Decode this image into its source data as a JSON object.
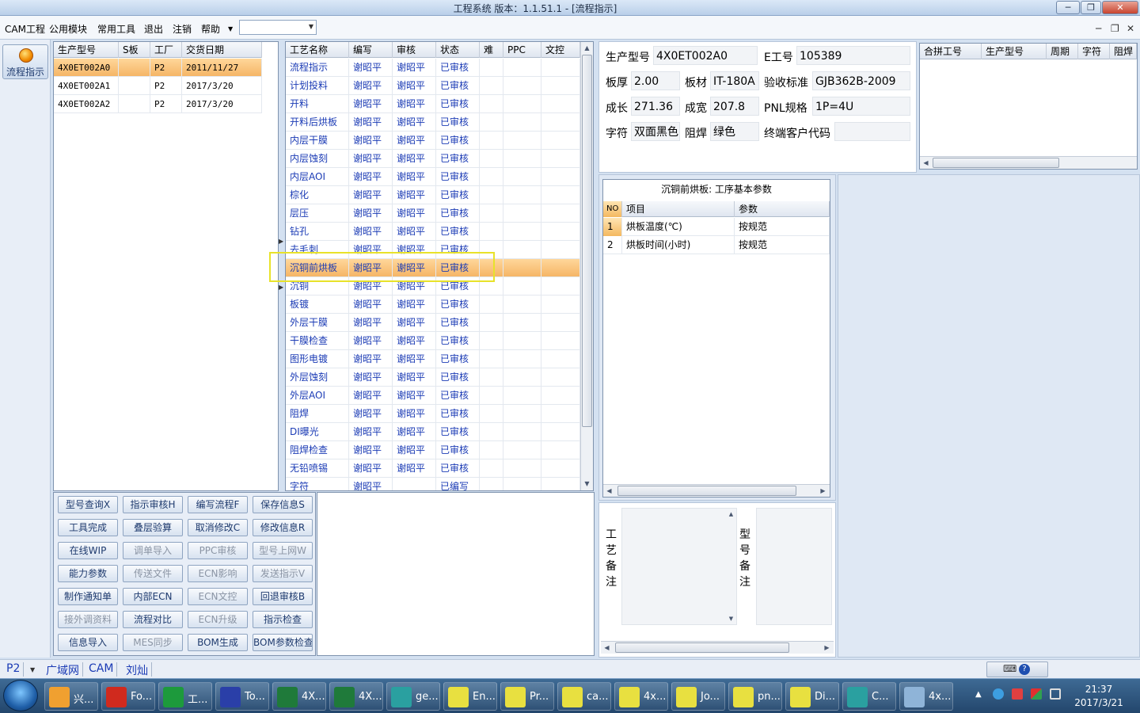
{
  "window": {
    "title": "工程系统   版本：1.1.51.1 - [流程指示]"
  },
  "menu": {
    "items": [
      "CAM工程",
      "公用模块",
      "常用工具",
      "退出",
      "注销",
      "帮助"
    ],
    "combo_value": ""
  },
  "nav": {
    "label": "流程指示",
    "icon": "flow-icon"
  },
  "orders": {
    "headers": [
      "生产型号",
      "S板",
      "工厂",
      "交货日期"
    ],
    "rows": [
      [
        "4X0ET002A0",
        "",
        "P2",
        "2011/11/27"
      ],
      [
        "4X0ET002A1",
        "",
        "P2",
        "2017/3/20"
      ],
      [
        "4X0ET002A2",
        "",
        "P2",
        "2017/3/20"
      ]
    ],
    "selected": 0
  },
  "process": {
    "headers": [
      "工艺名称",
      "编写",
      "审核",
      "状态",
      "难",
      "PPC",
      "文控"
    ],
    "rows": [
      [
        "流程指示",
        "谢昭平",
        "谢昭平",
        "已审核"
      ],
      [
        "计划投料",
        "谢昭平",
        "谢昭平",
        "已审核"
      ],
      [
        "开料",
        "谢昭平",
        "谢昭平",
        "已审核"
      ],
      [
        "开料后烘板",
        "谢昭平",
        "谢昭平",
        "已审核"
      ],
      [
        "内层干膜",
        "谢昭平",
        "谢昭平",
        "已审核"
      ],
      [
        "内层蚀刻",
        "谢昭平",
        "谢昭平",
        "已审核"
      ],
      [
        "内层AOI",
        "谢昭平",
        "谢昭平",
        "已审核"
      ],
      [
        "棕化",
        "谢昭平",
        "谢昭平",
        "已审核"
      ],
      [
        "层压",
        "谢昭平",
        "谢昭平",
        "已审核"
      ],
      [
        "钻孔",
        "谢昭平",
        "谢昭平",
        "已审核"
      ],
      [
        "去毛刺",
        "谢昭平",
        "谢昭平",
        "已审核"
      ],
      [
        "沉铜前烘板",
        "谢昭平",
        "谢昭平",
        "已审核"
      ],
      [
        "沉铜",
        "谢昭平",
        "谢昭平",
        "已审核"
      ],
      [
        "板镀",
        "谢昭平",
        "谢昭平",
        "已审核"
      ],
      [
        "外层干膜",
        "谢昭平",
        "谢昭平",
        "已审核"
      ],
      [
        "干膜检查",
        "谢昭平",
        "谢昭平",
        "已审核"
      ],
      [
        "图形电镀",
        "谢昭平",
        "谢昭平",
        "已审核"
      ],
      [
        "外层蚀刻",
        "谢昭平",
        "谢昭平",
        "已审核"
      ],
      [
        "外层AOI",
        "谢昭平",
        "谢昭平",
        "已审核"
      ],
      [
        "阻焊",
        "谢昭平",
        "谢昭平",
        "已审核"
      ],
      [
        "DI曝光",
        "谢昭平",
        "谢昭平",
        "已审核"
      ],
      [
        "阻焊检查",
        "谢昭平",
        "谢昭平",
        "已审核"
      ],
      [
        "无铅喷锡",
        "谢昭平",
        "谢昭平",
        "已审核"
      ],
      [
        "字符",
        "谢昭平",
        "",
        "已编写"
      ]
    ],
    "selected": 11
  },
  "actions": [
    [
      "型号查询X",
      "指示审核H",
      "编写流程F",
      "保存信息S"
    ],
    [
      "工具完成",
      "叠层验算",
      "取消修改C",
      "修改信息R"
    ],
    [
      "在线WIP",
      "调单导入",
      "PPC审核",
      "型号上网W"
    ],
    [
      "能力参数",
      "传送文件",
      "ECN影响",
      "发送指示V"
    ],
    [
      "制作通知单",
      "内部ECN",
      "ECN文控",
      "回退审核B"
    ],
    [
      "接外调资料",
      "流程对比",
      "ECN升级",
      "指示检查"
    ],
    [
      "信息导入",
      "MES同步",
      "BOM生成",
      "BOM参数检查"
    ]
  ],
  "actions_disabled": [
    "调单导入",
    "PPC审核",
    "型号上网W",
    "传送文件",
    "ECN影响",
    "发送指示V",
    "ECN文控",
    "接外调资料",
    "ECN升级",
    "MES同步"
  ],
  "info": {
    "product_label": "生产型号",
    "product": "4X0ET002A0",
    "eno_label": "E工号",
    "eno": "105389",
    "thick_label": "板厚",
    "thick": "2.00",
    "material_label": "板材",
    "material": "IT-180A",
    "std_label": "验收标准",
    "std": "GJB362B-2009",
    "len_label": "成长",
    "len": "271.36",
    "wid_label": "成宽",
    "wid": "207.8",
    "pnl_label": "PNL规格",
    "pnl": "1P=4U",
    "char_label": "字符",
    "char": "双面黑色",
    "mask_label": "阻焊",
    "mask": "绿色",
    "cust_label": "终端客户代码",
    "cust": ""
  },
  "merge": {
    "headers": [
      "合拼工号",
      "生产型号",
      "周期",
      "字符",
      "阻焊"
    ]
  },
  "params": {
    "title": "沉铜前烘板: 工序基本参数",
    "headers": [
      "NO",
      "项目",
      "参数"
    ],
    "rows": [
      [
        "1",
        "烘板温度(℃)",
        "按规范"
      ],
      [
        "2",
        "烘板时间(小时)",
        "按规范"
      ]
    ]
  },
  "notes": {
    "process_label": "工艺备注",
    "model_label": "型号备注"
  },
  "status": {
    "factory": "P2",
    "tabs": [
      "广域网",
      "CAM",
      "刘灿"
    ]
  },
  "taskbar": {
    "items": [
      {
        "label": "兴...",
        "icon": "star-app-icon",
        "color": "#f0a030"
      },
      {
        "label": "Fo...",
        "icon": "foxit-icon",
        "color": "#d02a1e"
      },
      {
        "label": "工...",
        "icon": "project-app-icon",
        "color": "#1d9a3c"
      },
      {
        "label": "To...",
        "icon": "save-app-icon",
        "color": "#2a3fa8"
      },
      {
        "label": "4X...",
        "icon": "excel-icon",
        "color": "#1f7a3a"
      },
      {
        "label": "4X...",
        "icon": "excel-icon",
        "color": "#1f7a3a"
      },
      {
        "label": "ge...",
        "icon": "genesis-icon",
        "color": "#2aa0a0"
      },
      {
        "label": "En...",
        "icon": "x-window-icon",
        "color": "#e8e040"
      },
      {
        "label": "Pr...",
        "icon": "x-window-icon",
        "color": "#e8e040"
      },
      {
        "label": "ca...",
        "icon": "x-window-icon",
        "color": "#e8e040"
      },
      {
        "label": "4x...",
        "icon": "x-window-icon",
        "color": "#e8e040"
      },
      {
        "label": "Jo...",
        "icon": "x-window-icon",
        "color": "#e8e040"
      },
      {
        "label": "pn...",
        "icon": "x-window-icon",
        "color": "#e8e040"
      },
      {
        "label": "Di...",
        "icon": "x-window-icon",
        "color": "#e8e040"
      },
      {
        "label": "C...",
        "icon": "genesis-icon",
        "color": "#2aa0a0"
      },
      {
        "label": "4x...",
        "icon": "notepad-icon",
        "color": "#8fb4d8"
      }
    ],
    "time": "21:37",
    "date": "2017/3/21"
  }
}
